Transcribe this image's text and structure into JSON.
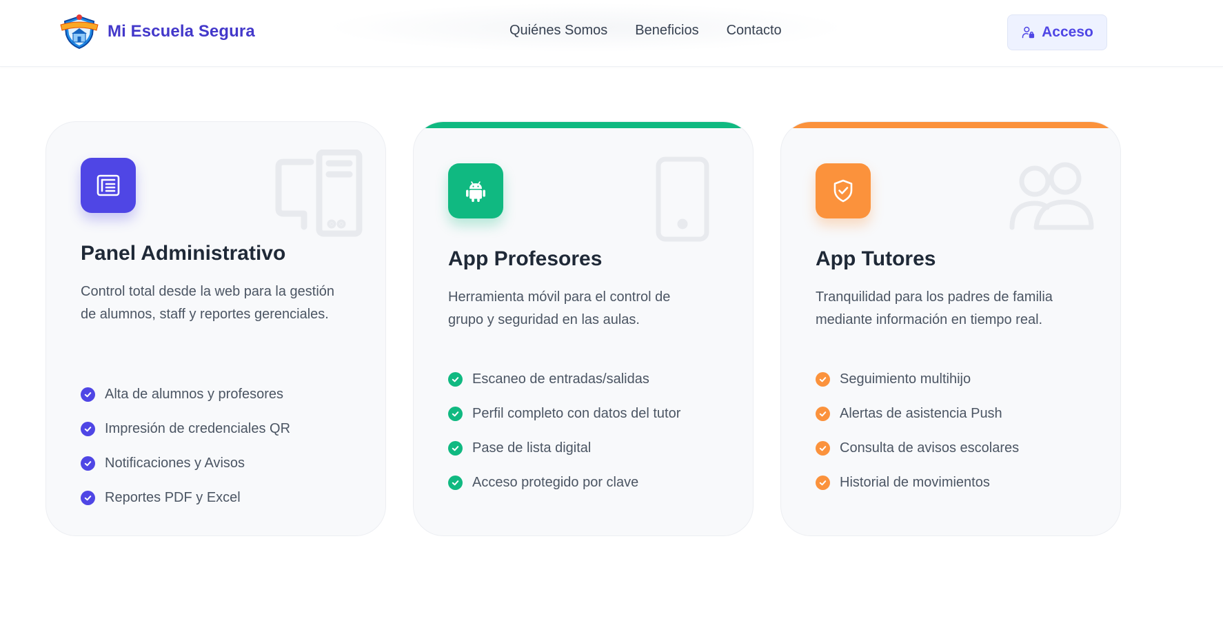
{
  "header": {
    "brand_name": "Mi Escuela Segura",
    "nav": [
      "Quiénes Somos",
      "Beneficios",
      "Contacto"
    ],
    "login_label": "Acceso",
    "logo_icon": "school-shield-logo",
    "login_icon": "user-lock-icon"
  },
  "colors": {
    "brand": "#4338ca",
    "primary": "#4f46e5",
    "green": "#10b981",
    "orange": "#fb923c",
    "card_bg": "#f8f9fb"
  },
  "cards": [
    {
      "title": "Panel Administrativo",
      "description": "Control total desde la web para la gestión de alumnos, staff y reportes gerenciales.",
      "icon": "newspaper-icon",
      "watermark_icon": "desktop-computer-icon",
      "accent": "#4f46e5",
      "features": [
        "Alta de alumnos y profesores",
        "Impresión de credenciales QR",
        "Notificaciones y Avisos",
        "Reportes PDF y Excel"
      ]
    },
    {
      "title": "App Profesores",
      "description": "Herramienta móvil para el control de grupo y seguridad en las aulas.",
      "icon": "android-icon",
      "watermark_icon": "smartphone-icon",
      "accent": "#10b981",
      "features": [
        "Escaneo de entradas/salidas",
        "Perfil completo con datos del tutor",
        "Pase de lista digital",
        "Acceso protegido por clave"
      ]
    },
    {
      "title": "App Tutores",
      "description": "Tranquilidad para los padres de familia mediante información en tiempo real.",
      "icon": "shield-check-icon",
      "watermark_icon": "users-icon",
      "accent": "#fb923c",
      "features": [
        "Seguimiento multihijo",
        "Alertas de asistencia Push",
        "Consulta de avisos escolares",
        "Historial de movimientos"
      ]
    }
  ]
}
